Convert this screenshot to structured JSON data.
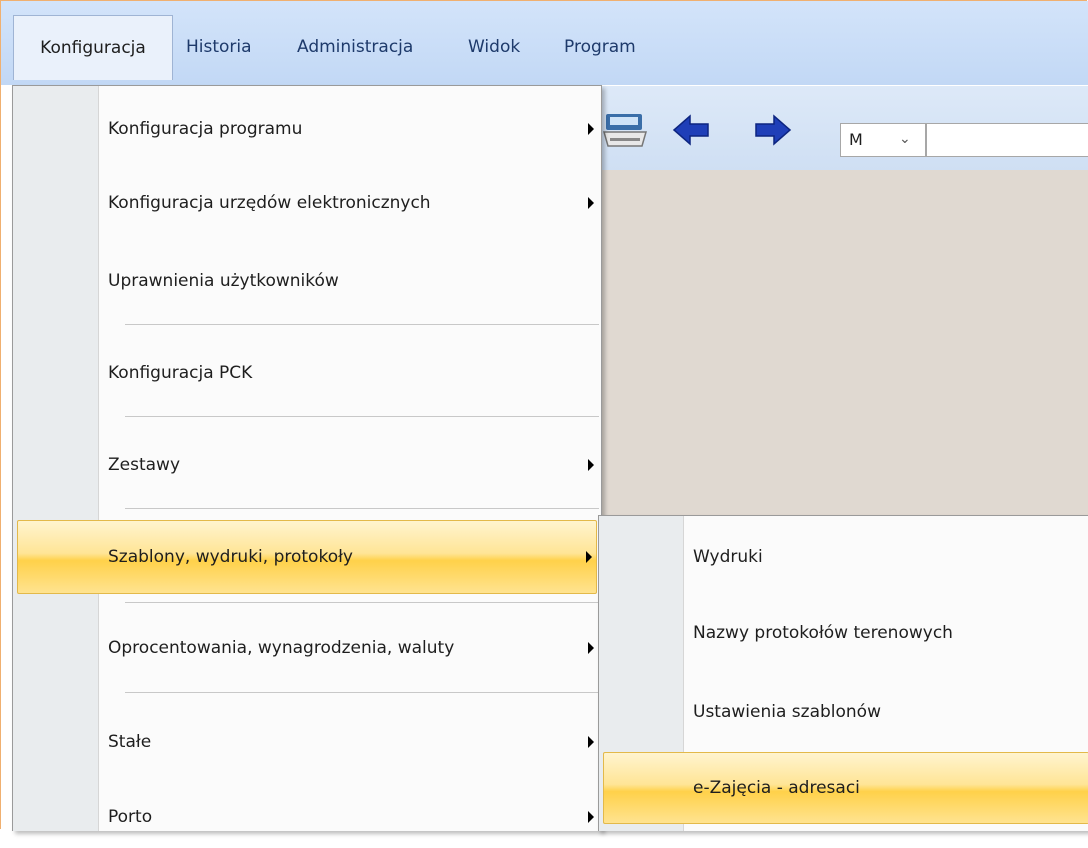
{
  "menubar": {
    "items": [
      {
        "label": "Konfiguracja"
      },
      {
        "label": "Historia"
      },
      {
        "label": "Administracja"
      },
      {
        "label": "Widok"
      },
      {
        "label": "Program"
      }
    ]
  },
  "toolbar": {
    "icons": [
      "scanner-icon",
      "back-arrow-icon",
      "forward-arrow-icon"
    ],
    "combo_value": "M",
    "search_value": ""
  },
  "konfiguracja_menu": {
    "items": [
      {
        "label": "Konfiguracja programu",
        "submenu": true
      },
      {
        "label": "Konfiguracja urzędów elektronicznych",
        "submenu": true
      },
      {
        "label": "Uprawnienia użytkowników",
        "submenu": false
      },
      {
        "label": "Konfiguracja PCK",
        "submenu": false
      },
      {
        "label": "Zestawy",
        "submenu": true
      },
      {
        "label": "Szablony, wydruki, protokoły",
        "submenu": true,
        "highlighted": true
      },
      {
        "label": "Oprocentowania, wynagrodzenia, waluty",
        "submenu": true
      },
      {
        "label": "Stałe",
        "submenu": true
      },
      {
        "label": "Porto",
        "submenu": true
      }
    ]
  },
  "szablony_submenu": {
    "items": [
      {
        "label": "Wydruki"
      },
      {
        "label": "Nazwy protokołów terenowych"
      },
      {
        "label": "Ustawienia szablonów"
      },
      {
        "label": "e-Zajęcia - adresaci",
        "highlighted": true
      }
    ]
  },
  "colors": {
    "menubar": "#c8dcf6",
    "highlight": "#ffd14a",
    "workspace": "#e0d9d1"
  }
}
